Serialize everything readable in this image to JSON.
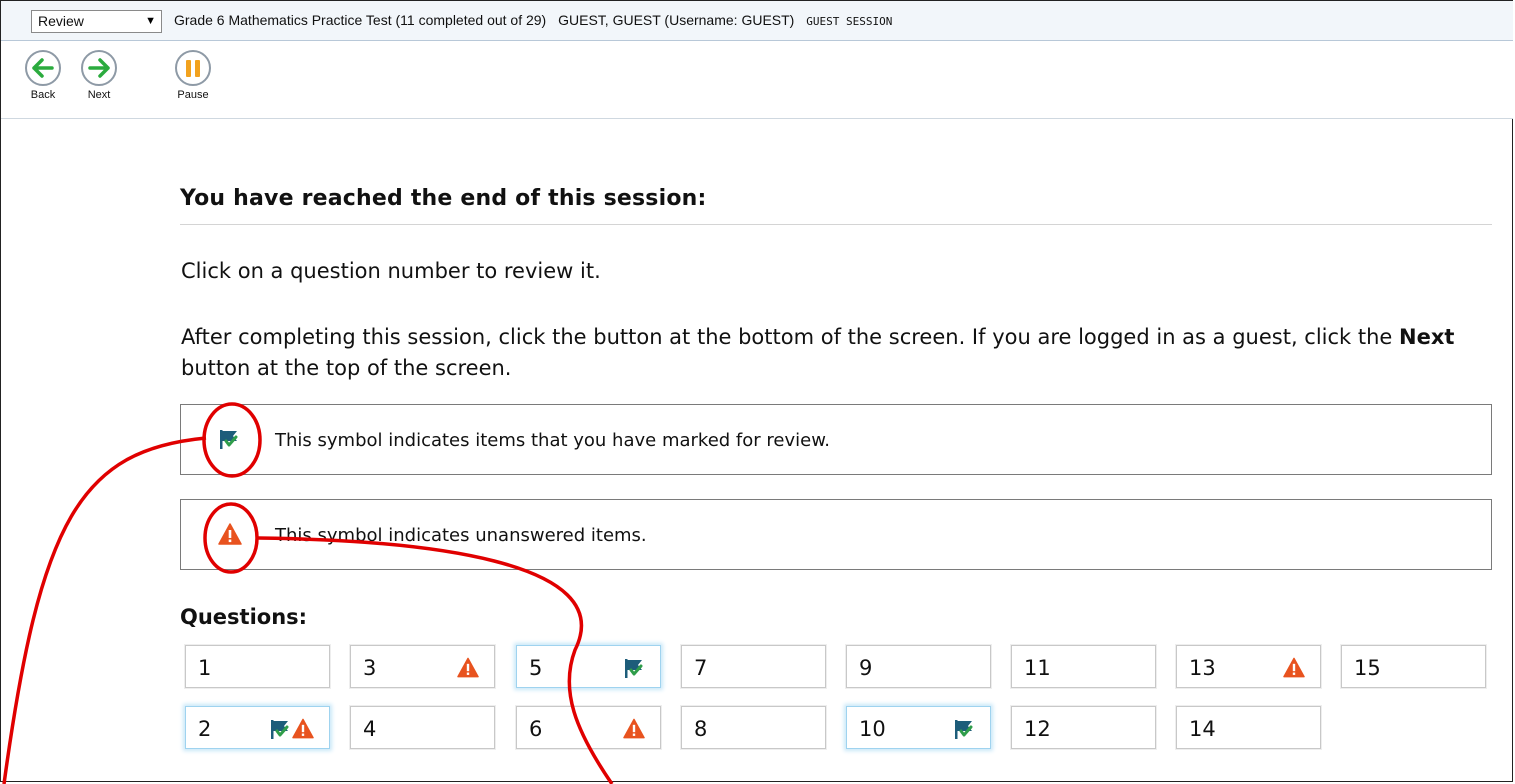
{
  "topbar": {
    "review_selected": "Review",
    "test_title": "Grade 6 Mathematics Practice Test (11 completed out of 29)",
    "user_info": "GUEST, GUEST (Username: GUEST)",
    "session_label": "GUEST SESSION"
  },
  "toolbar": {
    "back_label": "Back",
    "next_label": "Next",
    "pause_label": "Pause"
  },
  "main": {
    "heading": "You have reached the end of this session:",
    "instruction": "Click on a question number to review it.",
    "para_before_bold": "After completing this session, click the button at the bottom of the screen. If you are logged in as a guest, click the ",
    "para_bold": "Next",
    "para_after_bold": " button at the top of the screen.",
    "legend_marked": "This symbol indicates items that you have marked for review.",
    "legend_unanswered": "This symbol indicates unanswered items.",
    "questions_heading": "Questions:"
  },
  "questions": [
    {
      "number": "1",
      "marked": false,
      "unanswered": false
    },
    {
      "number": "2",
      "marked": true,
      "unanswered": true
    },
    {
      "number": "3",
      "marked": false,
      "unanswered": true
    },
    {
      "number": "4",
      "marked": false,
      "unanswered": false
    },
    {
      "number": "5",
      "marked": true,
      "unanswered": false
    },
    {
      "number": "6",
      "marked": false,
      "unanswered": true
    },
    {
      "number": "7",
      "marked": false,
      "unanswered": false
    },
    {
      "number": "8",
      "marked": false,
      "unanswered": false
    },
    {
      "number": "9",
      "marked": false,
      "unanswered": false
    },
    {
      "number": "10",
      "marked": true,
      "unanswered": false
    },
    {
      "number": "11",
      "marked": false,
      "unanswered": false
    },
    {
      "number": "12",
      "marked": false,
      "unanswered": false
    },
    {
      "number": "13",
      "marked": false,
      "unanswered": true
    },
    {
      "number": "14",
      "marked": false,
      "unanswered": false
    },
    {
      "number": "15",
      "marked": false,
      "unanswered": false
    }
  ],
  "icons": {
    "back": "arrow-left-icon",
    "next": "arrow-right-icon",
    "pause": "pause-icon",
    "marked": "flag-check-icon",
    "unanswered": "warning-triangle-icon"
  },
  "colors": {
    "flag": "#1d5d7a",
    "check": "#2f9d4a",
    "warning": "#e8531f",
    "annotation": "#e00000",
    "arrow": "#2bab3e",
    "pause": "#f2a21e"
  }
}
